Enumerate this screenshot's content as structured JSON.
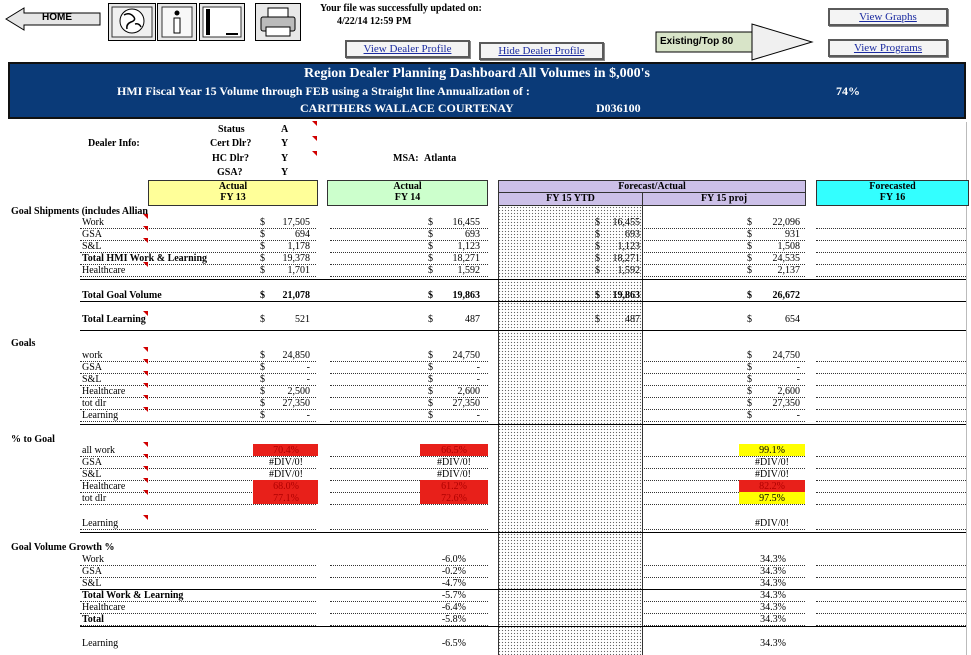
{
  "nav": {
    "home_label": "HOME",
    "status_line1": "Your file was successfully updated on:",
    "status_line2": "4/22/14 12:59 PM",
    "view_dealer_profile": "View Dealer Profile",
    "hide_dealer_profile": "Hide Dealer Profile",
    "existing_top80": "Existing/Top 80",
    "view_graphs": "View Graphs",
    "view_programs": "View Programs"
  },
  "banner": {
    "title": "Region Dealer Planning Dashboard  All Volumes in $,000's",
    "subtitle": "HMI Fiscal Year 15 Volume through FEB using a Straight line Annualization of :",
    "dealer_name": "CARITHERS WALLACE COURTENAY",
    "dealer_code": "D036100",
    "percent": "74%"
  },
  "dealer_info": {
    "label": "Dealer Info:",
    "status_label": "Status",
    "status_value": "A",
    "cert_label": "Cert Dlr?",
    "cert_value": "Y",
    "hc_label": "HC Dlr?",
    "hc_value": "Y",
    "gsa_label": "GSA?",
    "gsa_value": "Y",
    "msa_label": "MSA:",
    "msa_value": "Atlanta"
  },
  "columns": {
    "fy13": {
      "line1": "Actual",
      "line2": "FY 13"
    },
    "fy14": {
      "line1": "Actual",
      "line2": "FY 14"
    },
    "forecast_actual": "Forecast/Actual",
    "fy15ytd": "FY 15 YTD",
    "fy15proj": "FY 15 proj",
    "fy16": {
      "line1": "Forecasted",
      "line2": "FY 16"
    }
  },
  "sections": {
    "goal_shipments": "Goal Shipments (includes Allian",
    "goals": "Goals",
    "pct_to_goal": "% to Goal",
    "goal_volume_growth": "Goal Volume Growth %"
  },
  "shipments": {
    "rows": [
      {
        "label": "Work",
        "fy13": "17,505",
        "fy14": "16,455",
        "ytd": "16,455",
        "proj": "22,096"
      },
      {
        "label": "GSA",
        "fy13": "694",
        "fy14": "693",
        "ytd": "693",
        "proj": "931"
      },
      {
        "label": "S&L",
        "fy13": "1,178",
        "fy14": "1,123",
        "ytd": "1,123",
        "proj": "1,508"
      },
      {
        "label": "Total HMI Work & Learning",
        "fy13": "19,378",
        "fy14": "18,271",
        "ytd": "18,271",
        "proj": "24,535"
      },
      {
        "label": "Healthcare",
        "fy13": "1,701",
        "fy14": "1,592",
        "ytd": "1,592",
        "proj": "2,137"
      }
    ],
    "total_goal": {
      "label": "Total Goal Volume",
      "fy13": "21,078",
      "fy14": "19,863",
      "ytd": "19,863",
      "proj": "26,672"
    },
    "total_learning": {
      "label": "Total Learning",
      "fy13": "521",
      "fy14": "487",
      "ytd": "487",
      "proj": "654"
    },
    "dollar": "$"
  },
  "goals": {
    "rows": [
      {
        "label": "work",
        "fy13": "24,850",
        "fy14": "24,750",
        "proj": "24,750"
      },
      {
        "label": "GSA",
        "fy13": "-",
        "fy14": "-",
        "proj": "-"
      },
      {
        "label": "S&L",
        "fy13": "-",
        "fy14": "-",
        "proj": "-"
      },
      {
        "label": "Healthcare",
        "fy13": "2,500",
        "fy14": "2,600",
        "proj": "2,600"
      },
      {
        "label": "tot dlr",
        "fy13": "27,350",
        "fy14": "27,350",
        "proj": "27,350"
      },
      {
        "label": "Learning",
        "fy13": "-",
        "fy14": "-",
        "proj": "-"
      }
    ]
  },
  "pct_to_goal": {
    "rows": [
      {
        "label": "all work",
        "fy13": "70.4%",
        "fy14": "66.5%",
        "proj": "99.1%"
      },
      {
        "label": "GSA",
        "fy13": "#DIV/0!",
        "fy14": "#DIV/0!",
        "proj": "#DIV/0!"
      },
      {
        "label": "S&L",
        "fy13": "#DIV/0!",
        "fy14": "#DIV/0!",
        "proj": "#DIV/0!"
      },
      {
        "label": "Healthcare",
        "fy13": "68.0%",
        "fy14": "61.2%",
        "proj": "82.2%"
      },
      {
        "label": "tot dlr",
        "fy13": "77.1%",
        "fy14": "72.6%",
        "proj": "97.5%"
      }
    ],
    "learning": {
      "label": "Learning",
      "proj": "#DIV/0!"
    },
    "colors": {
      "below": "#e8201a",
      "near": "#ffff00"
    }
  },
  "growth": {
    "rows": [
      {
        "label": "Work",
        "fy14": "-6.0%",
        "proj": "34.3%"
      },
      {
        "label": "GSA",
        "fy14": "-0.2%",
        "proj": "34.3%"
      },
      {
        "label": "S&L",
        "fy14": "-4.7%",
        "proj": "34.3%"
      },
      {
        "label": "Total Work & Learning",
        "fy14": "-5.7%",
        "proj": "34.3%"
      },
      {
        "label": "Healthcare",
        "fy14": "-6.4%",
        "proj": "34.3%"
      },
      {
        "label": "Total",
        "fy14": "-5.8%",
        "proj": "34.3%"
      }
    ],
    "learning": {
      "label": "Learning",
      "fy14": "-6.5%",
      "proj": "34.3%"
    }
  }
}
